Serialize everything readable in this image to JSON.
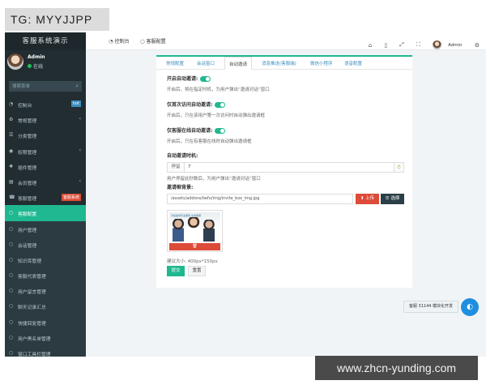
{
  "watermarks": {
    "top": "TG: MYYJJPP",
    "bottom": "www.zhcn-yunding.com"
  },
  "sidebar": {
    "brand": "客服系统演示",
    "user": {
      "name": "Admin",
      "status": "在线"
    },
    "search_placeholder": "搜索菜单",
    "items": [
      {
        "label": "控制台",
        "icon": "dashboard-icon",
        "badge": "hot"
      },
      {
        "label": "常规管理",
        "icon": "gear-icon"
      },
      {
        "label": "分类管理",
        "icon": "list-icon"
      },
      {
        "label": "权限管理",
        "icon": "group-icon"
      },
      {
        "label": "插件管理",
        "icon": "puzzle-icon"
      },
      {
        "label": "会员管理",
        "icon": "users-icon"
      },
      {
        "label": "客服管理",
        "icon": "headset-icon",
        "badge": "客服系统"
      },
      {
        "label": "客服配置",
        "icon": "circle-icon"
      },
      {
        "label": "用户管理",
        "icon": "circle-icon"
      },
      {
        "label": "会话管理",
        "icon": "circle-icon"
      },
      {
        "label": "知识库管理",
        "icon": "circle-icon"
      },
      {
        "label": "客服代表管理",
        "icon": "circle-icon"
      },
      {
        "label": "用户留言管理",
        "icon": "circle-icon"
      },
      {
        "label": "聊天记录汇总",
        "icon": "circle-icon"
      },
      {
        "label": "快捷回复管理",
        "icon": "circle-icon"
      },
      {
        "label": "用户黑名单管理",
        "icon": "circle-icon"
      },
      {
        "label": "窗口工具栏管理",
        "icon": "circle-icon"
      }
    ]
  },
  "topbar": {
    "breadcrumb": [
      "控制台",
      "客服配置"
    ],
    "admin_label": "Admin"
  },
  "tabs": [
    "常规配置",
    "会话窗口",
    "自动邀请",
    "消息推送(客服端)",
    "微信小程序",
    "语音配置"
  ],
  "active_tab": "自动邀请",
  "form": {
    "auto_invite": {
      "title": "开启自动邀请:",
      "help": "开启后，将在指定时机，为用户弹出“邀请对话”窗口",
      "enabled": true
    },
    "first_visit": {
      "title": "仅首次访问自动邀请:",
      "help": "开启后，只在该用户第一次访问时自动弹出邀请框",
      "enabled": true
    },
    "online_only": {
      "title": "仅客服在线自动邀请:",
      "help": "开启后，只在有客服在线时自动弹出邀请框",
      "enabled": true
    },
    "invite_time": {
      "title": "自动邀请时机:",
      "prefix": "停留",
      "value": "7",
      "help": "用户停留此秒数后，为用户弹出“邀请对话”窗口"
    },
    "invite_bg": {
      "title": "邀请框背景:",
      "path": "/assets/addons/kefu/img/invite_box_img.jpg",
      "upload_label": "上传",
      "select_label": "选择",
      "preview_text": "为您提供专业服务 在线客服",
      "size_hint": "建议大小: 400px*150px"
    },
    "submit_label": "提交",
    "reset_label": "重置"
  },
  "chat": {
    "pill_text": "客服 31144 模块化开发"
  }
}
